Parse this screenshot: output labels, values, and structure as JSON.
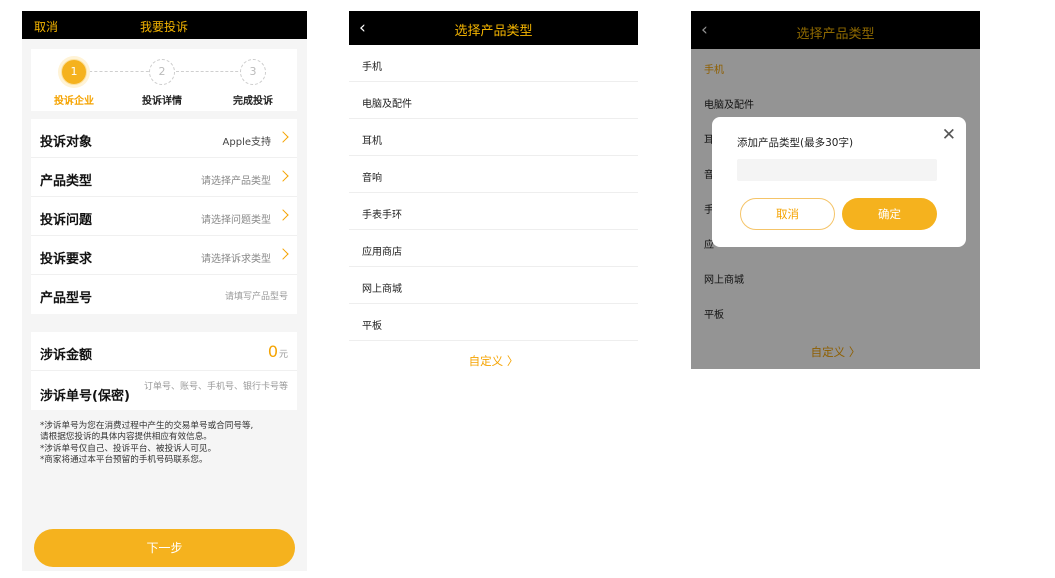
{
  "screen1": {
    "header": {
      "cancel": "取消",
      "title": "我要投诉"
    },
    "steps": [
      {
        "num": "1",
        "label": "投诉企业"
      },
      {
        "num": "2",
        "label": "投诉详情"
      },
      {
        "num": "3",
        "label": "完成投诉"
      }
    ],
    "form": {
      "target": {
        "label": "投诉对象",
        "value": "Apple支持"
      },
      "product_type": {
        "label": "产品类型",
        "value": "请选择产品类型"
      },
      "issue": {
        "label": "投诉问题",
        "value": "请选择问题类型"
      },
      "demand": {
        "label": "投诉要求",
        "value": "请选择诉求类型"
      },
      "model": {
        "label": "产品型号",
        "placeholder": "请填写产品型号"
      },
      "amount": {
        "label": "涉诉金额",
        "value": "0",
        "unit": "元"
      },
      "order": {
        "label": "涉诉单号(保密)",
        "placeholder": "订单号、账号、手机号、银行卡号等"
      }
    },
    "notes": [
      "*涉诉单号为您在消费过程中产生的交易单号或合同号等,",
      "请根据您投诉的具体内容提供相应有效信息。",
      "*涉诉单号仅自己、投诉平台、被投诉人可见。",
      "*商家将通过本平台预留的手机号码联系您。"
    ],
    "next_button": "下一步"
  },
  "screen2": {
    "header": {
      "back": "‹",
      "title": "选择产品类型"
    },
    "items": [
      "手机",
      "电脑及配件",
      "耳机",
      "音响",
      "手表手环",
      "应用商店",
      "网上商城",
      "平板"
    ],
    "custom": "自定义 〉"
  },
  "screen3": {
    "header": {
      "back": "‹",
      "title": "选择产品类型"
    },
    "items": [
      "手机",
      "电脑及配件",
      "耳",
      "音",
      "手",
      "应",
      "网上商城",
      "平板"
    ],
    "custom": "自定义 〉",
    "modal": {
      "title": "添加产品类型(最多30字)",
      "close": "✕",
      "input_value": "",
      "cancel": "取消",
      "ok": "确定"
    }
  },
  "colors": {
    "accent": "#f5b21e",
    "accent_text": "#f5a300",
    "header_bg": "#000000"
  }
}
